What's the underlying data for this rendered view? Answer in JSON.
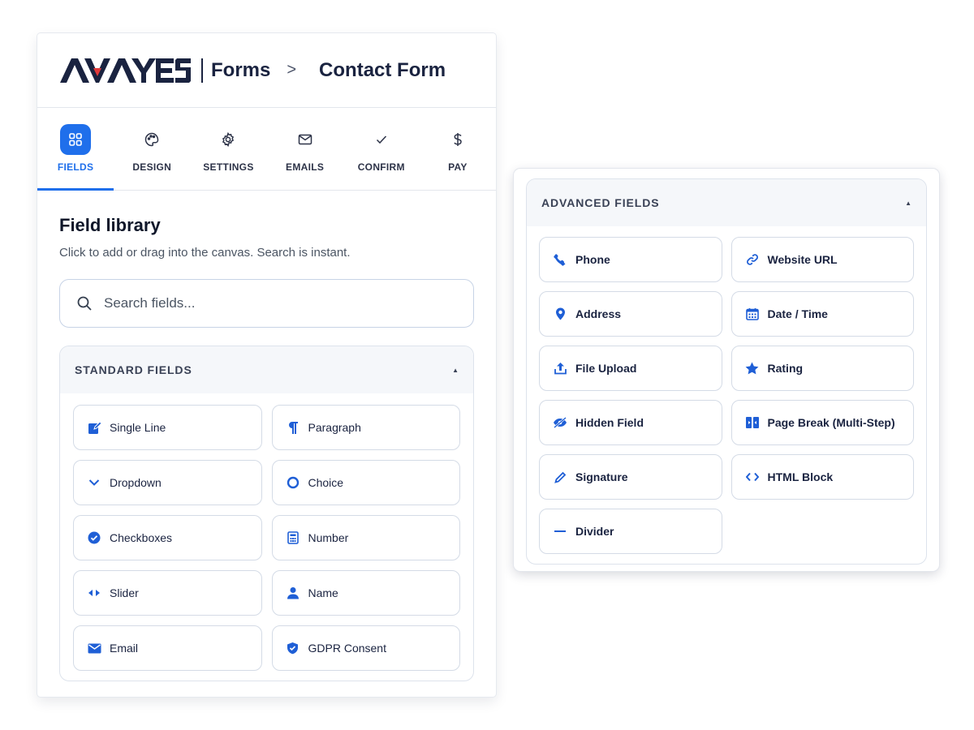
{
  "brand": {
    "logo_text": "AVAYES",
    "section": "Forms",
    "separator": ">",
    "page": "Contact Form"
  },
  "tabs": [
    {
      "label": "FIELDS",
      "icon": "grid-icon",
      "active": true
    },
    {
      "label": "DESIGN",
      "icon": "palette-icon",
      "active": false
    },
    {
      "label": "SETTINGS",
      "icon": "gear-icon",
      "active": false
    },
    {
      "label": "EMAILS",
      "icon": "envelope-icon",
      "active": false
    },
    {
      "label": "CONFIRM",
      "icon": "check-icon",
      "active": false
    },
    {
      "label": "PAY",
      "icon": "dollar-icon",
      "active": false
    }
  ],
  "library": {
    "title": "Field library",
    "subtitle": "Click to add or drag into the canvas. Search is instant.",
    "search_placeholder": "Search fields..."
  },
  "standard_fields": {
    "title": "STANDARD FIELDS",
    "expanded": true,
    "items": [
      {
        "label": "Single Line",
        "icon": "edit-icon"
      },
      {
        "label": "Paragraph",
        "icon": "pilcrow-icon"
      },
      {
        "label": "Dropdown",
        "icon": "chevron-down-icon"
      },
      {
        "label": "Choice",
        "icon": "radio-icon"
      },
      {
        "label": "Checkboxes",
        "icon": "check-circle-icon"
      },
      {
        "label": "Number",
        "icon": "calculator-icon"
      },
      {
        "label": "Slider",
        "icon": "slider-arrows-icon"
      },
      {
        "label": "Name",
        "icon": "user-icon"
      },
      {
        "label": "Email",
        "icon": "envelope-icon"
      },
      {
        "label": "GDPR Consent",
        "icon": "shield-icon"
      }
    ]
  },
  "advanced_fields": {
    "title": "ADVANCED FIELDS",
    "expanded": true,
    "items": [
      {
        "label": "Phone",
        "icon": "phone-icon"
      },
      {
        "label": "Website URL",
        "icon": "link-icon"
      },
      {
        "label": "Address",
        "icon": "map-pin-icon"
      },
      {
        "label": "Date / Time",
        "icon": "calendar-icon"
      },
      {
        "label": "File Upload",
        "icon": "upload-icon"
      },
      {
        "label": "Rating",
        "icon": "star-icon"
      },
      {
        "label": "Hidden Field",
        "icon": "eye-slash-icon"
      },
      {
        "label": "Page Break (Multi-Step)",
        "icon": "page-break-icon"
      },
      {
        "label": "Signature",
        "icon": "pen-icon"
      },
      {
        "label": "HTML Block",
        "icon": "code-icon"
      },
      {
        "label": "Divider",
        "icon": "minus-icon"
      }
    ]
  },
  "colors": {
    "accent": "#1f6feb",
    "icon": "#1f5fd6",
    "text": "#1a2340",
    "logo_red": "#e23a3a"
  }
}
